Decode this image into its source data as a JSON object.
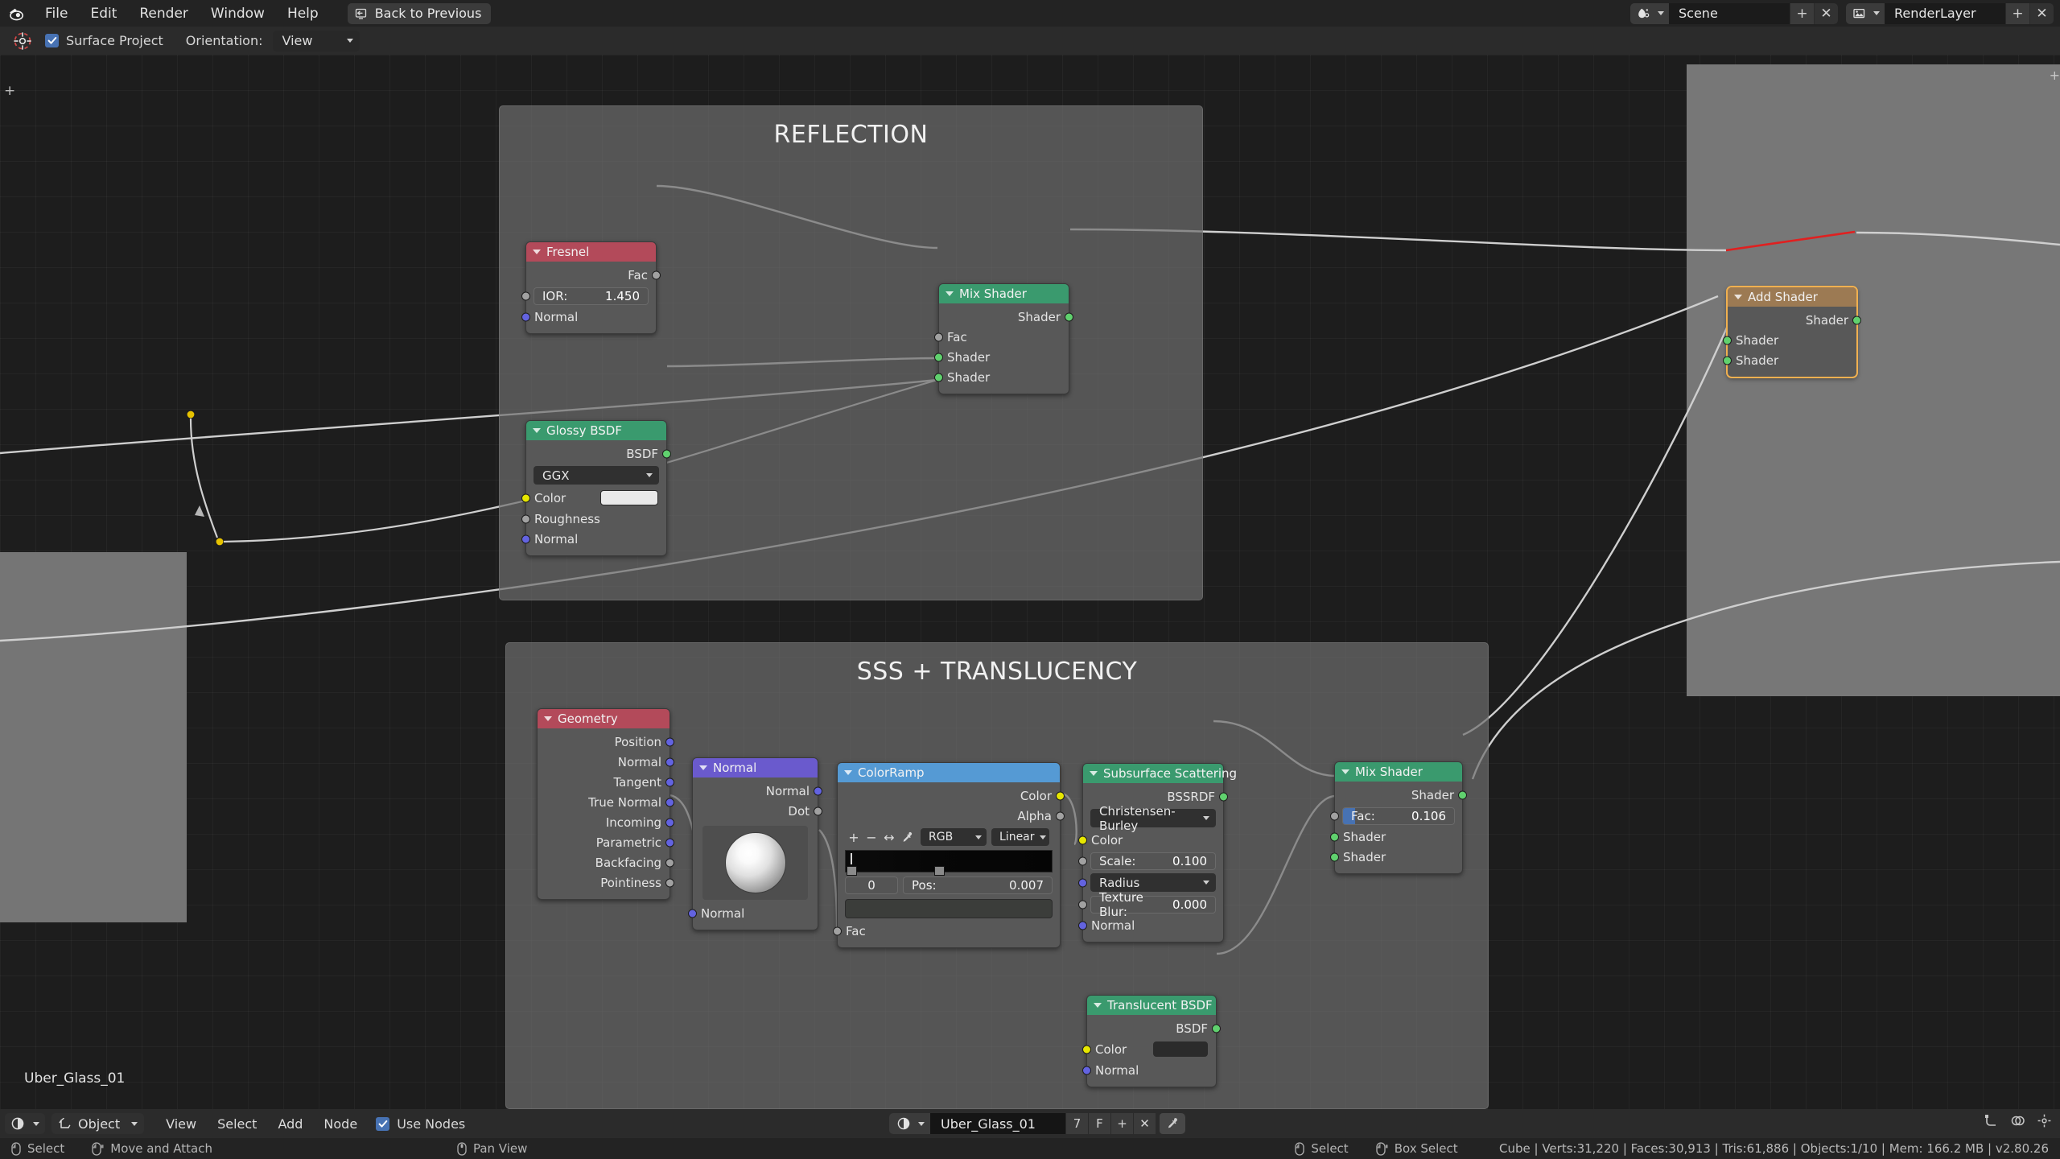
{
  "topbar": {
    "logo_icon": "blender-logo-icon",
    "menus": [
      "File",
      "Edit",
      "Render",
      "Window",
      "Help"
    ],
    "back_button": {
      "label": "Back to Previous",
      "icon": "back-to-previous-icon"
    },
    "scene": {
      "icon": "scene-icon",
      "name": "Scene",
      "add_label": "+",
      "remove_label": "✕"
    },
    "viewlayer": {
      "icon": "render-layer-icon",
      "name": "RenderLayer",
      "add_label": "+",
      "remove_label": "✕"
    }
  },
  "toolheader": {
    "gizmo_icon": "snap-cursor-icon",
    "surface_project": {
      "label": "Surface Project",
      "checked": true
    },
    "orientation": {
      "label": "Orientation:",
      "value": "View"
    }
  },
  "canvas": {
    "cursor_plus": "+",
    "backdrop_plus": "+",
    "active_node_label": "Uber_Glass_01"
  },
  "frames": [
    {
      "title": "REFLECTION"
    },
    {
      "title": "SSS + TRANSLUCENCY"
    }
  ],
  "colors": {
    "header_shader": "#3a9a6e",
    "header_input_red": "#b34a5a",
    "header_vector_purple": "#6a5acd",
    "header_converter_blue": "#559ad4",
    "header_add_shader": "#9c7a53",
    "socket_shader": "#60d16e",
    "socket_color": "#e6e600",
    "socket_vector": "#6363e0",
    "socket_value": "#a1a1a1",
    "accent_blue": "#4772b3",
    "link_red": "#e02020"
  },
  "nodes": {
    "fresnel": {
      "title": "Fresnel",
      "outputs": [
        "Fac"
      ],
      "ior": {
        "label": "IOR:",
        "value": "1.450"
      },
      "inputs": [
        "Normal"
      ]
    },
    "glossy": {
      "title": "Glossy BSDF",
      "outputs": [
        "BSDF"
      ],
      "distribution": "GGX",
      "inputs": [
        "Color",
        "Roughness",
        "Normal"
      ],
      "color_swatch": "#e9e9e9"
    },
    "mix_shader_top": {
      "title": "Mix Shader",
      "outputs": [
        "Shader"
      ],
      "inputs": [
        "Fac",
        "Shader",
        "Shader"
      ]
    },
    "add_shader": {
      "title": "Add Shader",
      "outputs": [
        "Shader"
      ],
      "inputs": [
        "Shader",
        "Shader"
      ]
    },
    "geometry": {
      "title": "Geometry",
      "outputs": [
        "Position",
        "Normal",
        "Tangent",
        "True Normal",
        "Incoming",
        "Parametric",
        "Backfacing",
        "Pointiness"
      ]
    },
    "normal": {
      "title": "Normal",
      "outputs": [
        "Normal",
        "Dot"
      ],
      "inputs": [
        "Normal"
      ],
      "widget": "normal-sphere"
    },
    "colorramp": {
      "title": "ColorRamp",
      "outputs": [
        "Color",
        "Alpha"
      ],
      "tools": [
        "+",
        "−",
        "↔",
        "eyedropper-icon"
      ],
      "mode": "RGB",
      "interpolation": "Linear",
      "index": "0",
      "pos_label": "Pos:",
      "pos_value": "0.007",
      "inputs": [
        "Fac"
      ],
      "stops": [
        {
          "position": 0.0,
          "color": "#161616"
        },
        {
          "position": 0.45,
          "color": "#070707"
        }
      ]
    },
    "sss": {
      "title": "Subsurface Scattering",
      "outputs": [
        "BSSRDF"
      ],
      "falloff": "Christensen-Burley",
      "inputs": [
        "Color",
        "Normal"
      ],
      "scale": {
        "label": "Scale:",
        "value": "0.100"
      },
      "radius": "Radius",
      "texture_blur": {
        "label": "Texture Blur:",
        "value": "0.000"
      }
    },
    "mix_shader_bottom": {
      "title": "Mix Shader",
      "outputs": [
        "Shader"
      ],
      "fac": {
        "label": "Fac:",
        "value": "0.106",
        "fill": 0.106
      },
      "inputs": [
        "Shader",
        "Shader"
      ]
    },
    "translucent": {
      "title": "Translucent BSDF",
      "outputs": [
        "BSDF"
      ],
      "inputs": [
        "Color",
        "Normal"
      ],
      "color_swatch": "#2b2b2b"
    }
  },
  "editorbar": {
    "editor_type_icon": "shader-editor-icon",
    "mode_icon": "object-mode-icon",
    "mode": "Object",
    "menus": [
      "View",
      "Select",
      "Add",
      "Node"
    ],
    "use_nodes": {
      "label": "Use Nodes",
      "checked": true
    },
    "material": {
      "icon": "material-icon",
      "name": "Uber_Glass_01",
      "users": "7",
      "fake_user": "F",
      "new": "+",
      "unlink": "✕",
      "pick_icon": "eyedropper-icon"
    },
    "right_icons": [
      "snap-icon",
      "overlay-icon",
      "options-icon"
    ]
  },
  "statusbar": {
    "hints": [
      {
        "icon": "mouse-left-icon",
        "label": "Select"
      },
      {
        "icon": "mouse-left-drag-icon",
        "label": "Move and Attach"
      },
      {
        "icon": "mouse-middle-icon",
        "label": "Pan View"
      },
      {
        "icon": "mouse-left-icon",
        "label": "Select"
      },
      {
        "icon": "mouse-left-drag-icon",
        "label": "Box Select"
      }
    ],
    "stats": "Cube | Verts:31,220 | Faces:30,913 | Tris:61,886 | Objects:1/10 | Mem: 166.2 MB | v2.80.26"
  }
}
